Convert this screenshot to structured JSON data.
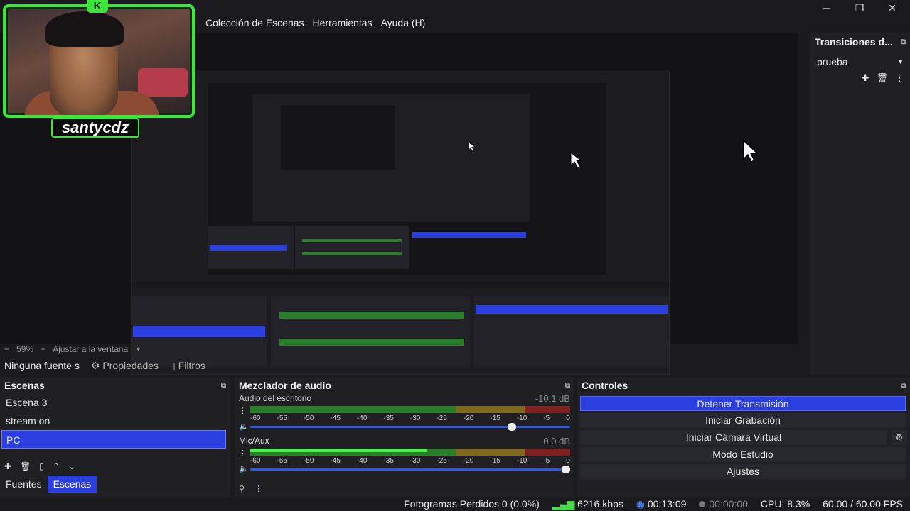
{
  "menu": [
    "Colección de Escenas",
    "Herramientas",
    "Ayuda (H)"
  ],
  "window_controls": [
    "minimize",
    "maximize",
    "close"
  ],
  "webcam": {
    "badge": "K",
    "name": "santycdz"
  },
  "transitions": {
    "title": "Transiciones d...",
    "selected": "prueba"
  },
  "zoom": {
    "percent": "59%",
    "fit_label": "Ajustar a la ventana"
  },
  "source_toolbar": {
    "no_source": "Ninguna fuente s",
    "properties": "Propiedades",
    "filters": "Filtros"
  },
  "scenes": {
    "title": "Escenas",
    "items": [
      "Escena 3",
      "stream on",
      "PC"
    ],
    "active_index": 2,
    "tabs": [
      "Fuentes",
      "Escenas"
    ]
  },
  "mixer": {
    "title": "Mezclador de audio",
    "ticks": [
      "-60",
      "-55",
      "-50",
      "-45",
      "-40",
      "-35",
      "-30",
      "-25",
      "-20",
      "-15",
      "-10",
      "-5",
      "0"
    ],
    "channels": [
      {
        "name": "Audio del escritorio",
        "db": "-10.1 dB",
        "level": 0.0,
        "volume": 0.83
      },
      {
        "name": "Mic/Aux",
        "db": "0.0 dB",
        "level": 0.55,
        "volume": 1.0
      }
    ]
  },
  "controls": {
    "title": "Controles",
    "buttons": [
      "Detener Transmisión",
      "Iniciar Grabación",
      "Iniciar Cámara Virtual",
      "Modo Estudio",
      "Ajustes"
    ]
  },
  "status": {
    "dropped": "Fotogramas Perdidos 0 (0.0%)",
    "bitrate": "6216 kbps",
    "stream_time": "00:13:09",
    "rec_time": "00:00:00",
    "cpu": "CPU: 8.3%",
    "fps": "60.00 / 60.00 FPS"
  },
  "colors": {
    "accent": "#2b3ee0",
    "webcam_frame": "#3de63d",
    "background": "#1b1b1f"
  }
}
